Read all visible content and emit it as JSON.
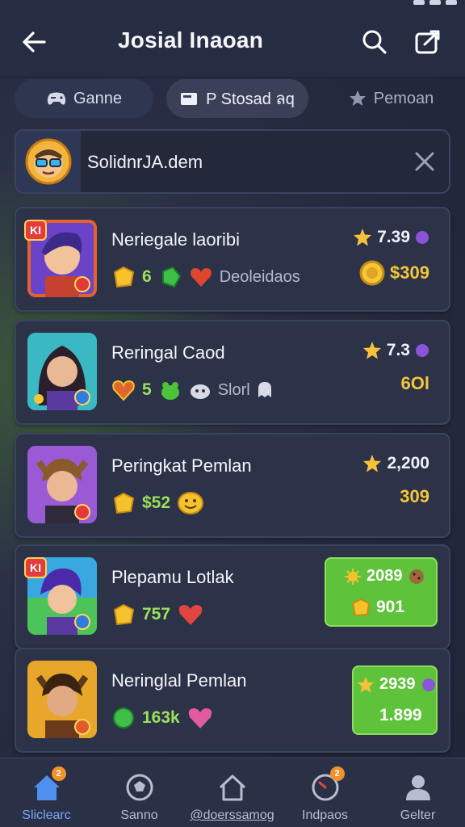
{
  "header": {
    "title": "Josial Inaoan"
  },
  "tabs": [
    {
      "label": "Ganne",
      "icon": "gamepad-icon"
    },
    {
      "label": "P Stosad ลq",
      "icon": "card-icon"
    },
    {
      "label": "Pemoan",
      "icon": "badge-icon"
    }
  ],
  "search": {
    "value": "SolidnrJA.dem"
  },
  "players": [
    {
      "name": "Neriegale laoribi",
      "tag": "KI",
      "stat_value": "6",
      "stat_text": "Deoleidaos",
      "rating": "7.39",
      "coins": "$309"
    },
    {
      "name": "Reringal Caod",
      "stat_value": "5",
      "stat_text": "Slorl",
      "rating": "7.3",
      "coins": "6Ol"
    },
    {
      "name": "Peringkat Pemlan",
      "stat_value": "$52",
      "rating": "2,200",
      "coins": "309"
    },
    {
      "name": "Plepamu Lotlak",
      "tag": "KI",
      "stat_value": "757",
      "highlight_top": "2089",
      "highlight_bottom": "901"
    },
    {
      "name": "Neringlal Pemlan",
      "stat_value": "163k",
      "highlight_top": "2939",
      "highlight_bottom": "1.899"
    }
  ],
  "nav": [
    {
      "label": "Sliclearc",
      "icon": "home-icon",
      "badge": "2",
      "active": true
    },
    {
      "label": "Sanno",
      "icon": "ball-icon"
    },
    {
      "label": "@doerssamog",
      "icon": "house-icon"
    },
    {
      "label": "Indpaos",
      "icon": "compass-icon",
      "badge": "2"
    },
    {
      "label": "Gelter",
      "icon": "person-icon"
    }
  ],
  "colors": {
    "accent_green": "#5ec33a",
    "gold": "#f4c638",
    "active_nav": "#78a9ff",
    "background": "#23283c"
  }
}
